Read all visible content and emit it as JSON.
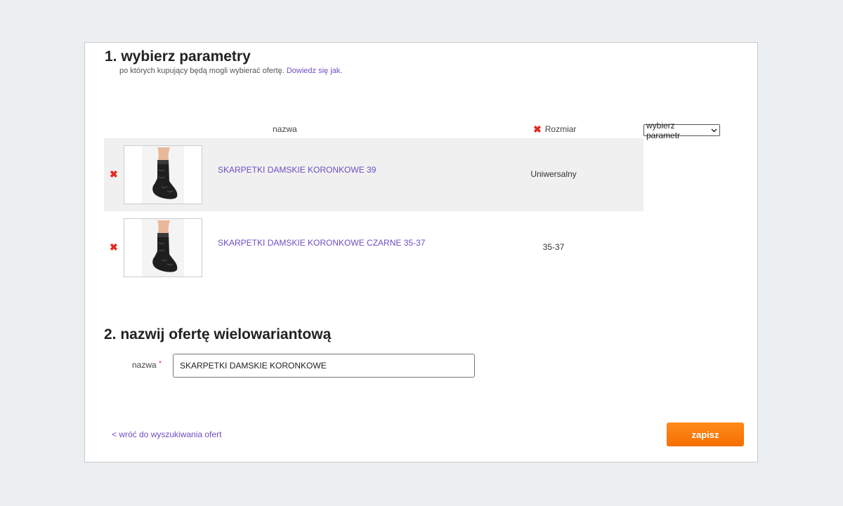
{
  "section1": {
    "title": "1. wybierz parametry",
    "subtitle": "po których kupujący będą mogli wybierać ofertę.",
    "learn_more": "Dowiedz się jak."
  },
  "table": {
    "col_name": "nazwa",
    "col_param": "Rozmiar",
    "select_placeholder": "wybierz parametr",
    "rows": [
      {
        "name": "SKARPETKI DAMSKIE KORONKOWE 39",
        "value": "Uniwersalny"
      },
      {
        "name": "SKARPETKI DAMSKIE KORONKOWE CZARNE 35-37",
        "value": "35-37"
      }
    ]
  },
  "section2": {
    "title": "2. nazwij ofertę wielowariantową",
    "name_label": "nazwa",
    "required_mark": "*",
    "name_value": "SKARPETKI DAMSKIE KORONKOWE"
  },
  "footer": {
    "back_link": "< wróć do wyszukiwania ofert",
    "save_label": "zapisz"
  },
  "colors": {
    "link": "#6c4fc2",
    "remove": "#e52822",
    "primary_button": "#f56f00"
  }
}
